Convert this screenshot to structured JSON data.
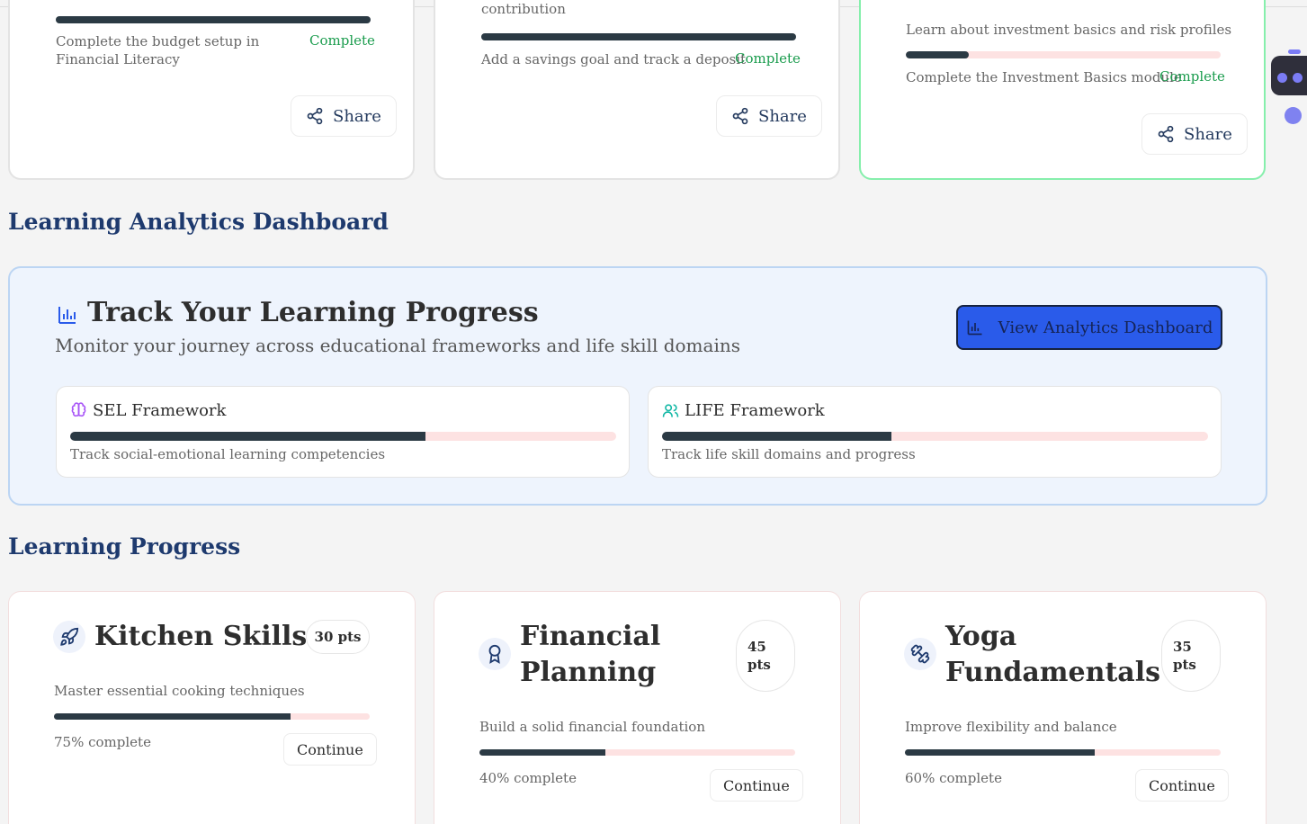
{
  "goal_cards": [
    {
      "text": "Complete the budget setup in Financial Literacy",
      "status": "Complete",
      "progress": 1.0,
      "share_label": "Share"
    },
    {
      "desc_fragment": "contribution",
      "text": "Add a savings goal and track a deposit",
      "status": "Complete",
      "progress": 1.0,
      "share_label": "Share"
    },
    {
      "desc": "Learn about investment basics and risk profiles",
      "text": "Complete the Investment Basics module",
      "status": "Complete",
      "progress": 0.2,
      "share_label": "Share"
    }
  ],
  "analytics_section": {
    "heading": "Learning Analytics Dashboard",
    "title": "Track Your Learning Progress",
    "subtitle": "Monitor your journey across educational frameworks and life skill domains",
    "button_label": "View Analytics Dashboard",
    "frameworks": [
      {
        "name": "SEL Framework",
        "desc": "Track social-emotional learning competencies",
        "progress": 0.65,
        "icon": "brain-icon",
        "icon_color": "#a855f7"
      },
      {
        "name": "LIFE Framework",
        "desc": "Track life skill domains and progress",
        "progress": 0.42,
        "icon": "users-icon",
        "icon_color": "#14b8a6"
      }
    ]
  },
  "learning_progress": {
    "heading": "Learning Progress",
    "cards": [
      {
        "title": "Kitchen Skills",
        "points": "30 pts",
        "desc": "Master essential cooking techniques",
        "progress": 0.75,
        "pct_label": "75% complete",
        "button": "Continue",
        "icon": "rocket-icon"
      },
      {
        "title": "Financial Planning",
        "points": "45 pts",
        "desc": "Build a solid financial foundation",
        "progress": 0.4,
        "pct_label": "40% complete",
        "button": "Continue",
        "icon": "award-icon"
      },
      {
        "title": "Yoga Fundamentals",
        "points": "35 pts",
        "desc": "Improve flexibility and balance",
        "progress": 0.6,
        "pct_label": "60% complete",
        "button": "Continue",
        "icon": "dumbbell-icon"
      }
    ]
  },
  "colors": {
    "accent": "#2a5bea",
    "complete": "#1a9c4d",
    "heading": "#1e3a6e",
    "bar": "#2b3a44",
    "track": "#fde2e2"
  }
}
